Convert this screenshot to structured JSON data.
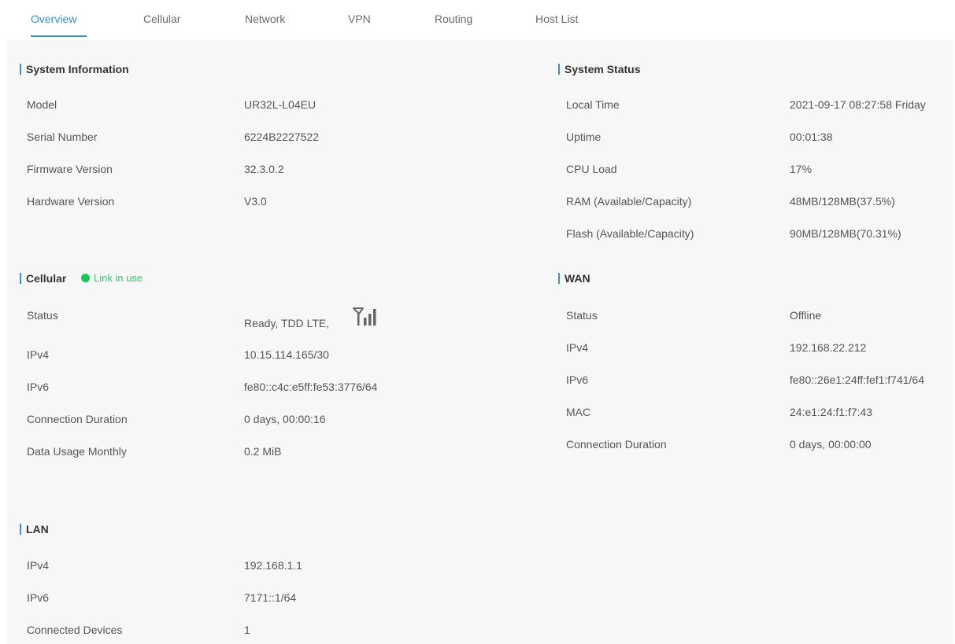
{
  "tabs": [
    {
      "label": "Overview",
      "active": true
    },
    {
      "label": "Cellular",
      "active": false
    },
    {
      "label": "Network",
      "active": false
    },
    {
      "label": "VPN",
      "active": false
    },
    {
      "label": "Routing",
      "active": false
    },
    {
      "label": "Host List",
      "active": false
    }
  ],
  "colors": {
    "accent": "#3c8fcc",
    "link_ok": "#21c35b"
  },
  "system_information": {
    "title": "System Information",
    "rows": [
      {
        "label": "Model",
        "value": "UR32L-L04EU"
      },
      {
        "label": "Serial Number",
        "value": "6224B2227522"
      },
      {
        "label": "Firmware Version",
        "value": "32.3.0.2"
      },
      {
        "label": "Hardware Version",
        "value": "V3.0"
      }
    ]
  },
  "system_status": {
    "title": "System Status",
    "rows": [
      {
        "label": "Local Time",
        "value": "2021-09-17 08:27:58 Friday"
      },
      {
        "label": "Uptime",
        "value": "00:01:38"
      },
      {
        "label": "CPU Load",
        "value": "17%"
      },
      {
        "label": "RAM (Available/Capacity)",
        "value": "48MB/128MB(37.5%)"
      },
      {
        "label": "Flash (Available/Capacity)",
        "value": "90MB/128MB(70.31%)"
      }
    ]
  },
  "cellular": {
    "title": "Cellular",
    "badge": "Link in use",
    "signal_icon": "signal-strength-icon",
    "rows": [
      {
        "label": "Status",
        "value": "Ready, TDD LTE,"
      },
      {
        "label": "IPv4",
        "value": "10.15.114.165/30"
      },
      {
        "label": "IPv6",
        "value": "fe80::c4c:e5ff:fe53:3776/64"
      },
      {
        "label": "Connection Duration",
        "value": "0 days, 00:00:16"
      },
      {
        "label": "Data Usage Monthly",
        "value": "0.2 MiB"
      }
    ]
  },
  "wan": {
    "title": "WAN",
    "rows": [
      {
        "label": "Status",
        "value": "Offline"
      },
      {
        "label": "IPv4",
        "value": "192.168.22.212"
      },
      {
        "label": "IPv6",
        "value": "fe80::26e1:24ff:fef1:f741/64"
      },
      {
        "label": "MAC",
        "value": "24:e1:24:f1:f7:43"
      },
      {
        "label": "Connection Duration",
        "value": "0 days, 00:00:00"
      }
    ]
  },
  "lan": {
    "title": "LAN",
    "rows": [
      {
        "label": "IPv4",
        "value": "192.168.1.1"
      },
      {
        "label": "IPv6",
        "value": "7171::1/64"
      },
      {
        "label": "Connected Devices",
        "value": "1"
      }
    ]
  }
}
